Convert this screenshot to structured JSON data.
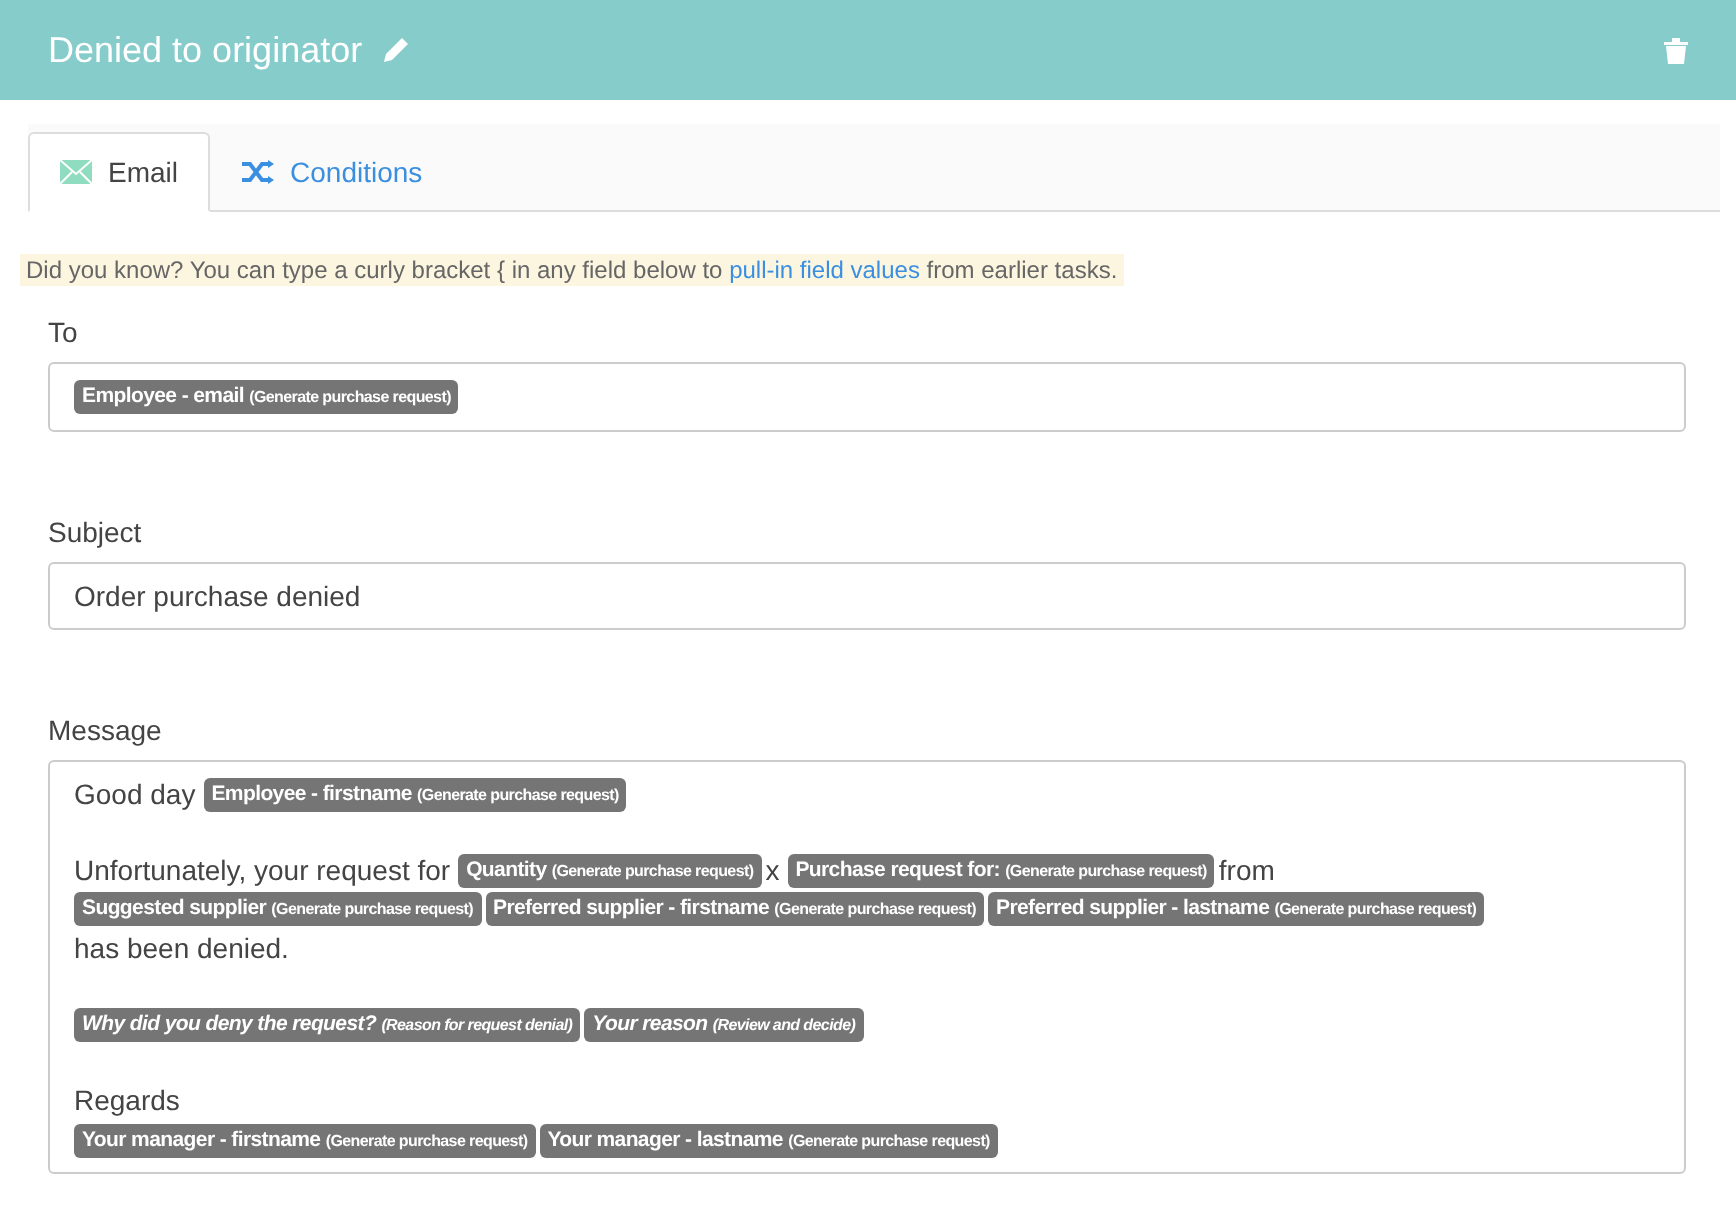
{
  "header": {
    "title": "Denied to originator"
  },
  "tabs": [
    {
      "label": "Email",
      "selected": true
    },
    {
      "label": "Conditions",
      "selected": false
    }
  ],
  "hint": {
    "before": "Did you know? You can type a curly bracket { in any field below to",
    "link": "pull-in field values",
    "after": "from earlier tasks."
  },
  "to": {
    "label": "To",
    "tokens": [
      {
        "label": "Employee - email",
        "source": "(Generate purchase request)",
        "italic": false
      }
    ]
  },
  "subject": {
    "label": "Subject",
    "value": "Order purchase denied"
  },
  "message": {
    "label": "Message",
    "paragraphs": [
      {
        "lines": [
          [
            {
              "kind": "text",
              "text": "Good day"
            },
            {
              "kind": "token",
              "label": "Employee - firstname",
              "source": "(Generate purchase request)",
              "italic": false
            }
          ]
        ]
      },
      {
        "lines": [
          [
            {
              "kind": "text",
              "text": "Unfortunately, your request for"
            },
            {
              "kind": "token",
              "label": "Quantity",
              "source": "(Generate purchase request)",
              "italic": false
            },
            {
              "kind": "text",
              "text": "x"
            },
            {
              "kind": "token",
              "label": "Purchase request for:",
              "source": "(Generate purchase request)",
              "italic": false
            },
            {
              "kind": "text",
              "text": "from"
            },
            {
              "kind": "token",
              "label": "Suggested supplier",
              "source": "(Generate purchase request)",
              "italic": false
            },
            {
              "kind": "token",
              "label": "Preferred supplier - firstname",
              "source": "(Generate purchase request)",
              "italic": false
            },
            {
              "kind": "token",
              "label": "Preferred supplier - lastname",
              "source": "(Generate purchase request)",
              "italic": false
            },
            {
              "kind": "text",
              "text": "has been denied."
            }
          ]
        ]
      },
      {
        "lines": [
          [
            {
              "kind": "token",
              "label": "Why did you deny the request?",
              "source": "(Reason for request denial)",
              "italic": true
            },
            {
              "kind": "token",
              "label": "Your reason",
              "source": "(Review and decide)",
              "italic": true
            }
          ]
        ]
      },
      {
        "lines": [
          [
            {
              "kind": "text",
              "text": "Regards"
            }
          ],
          [
            {
              "kind": "token",
              "label": "Your manager - firstname",
              "source": "(Generate purchase request)",
              "italic": false
            },
            {
              "kind": "token",
              "label": "Your manager - lastname",
              "source": "(Generate purchase request)",
              "italic": false
            }
          ]
        ]
      }
    ]
  }
}
